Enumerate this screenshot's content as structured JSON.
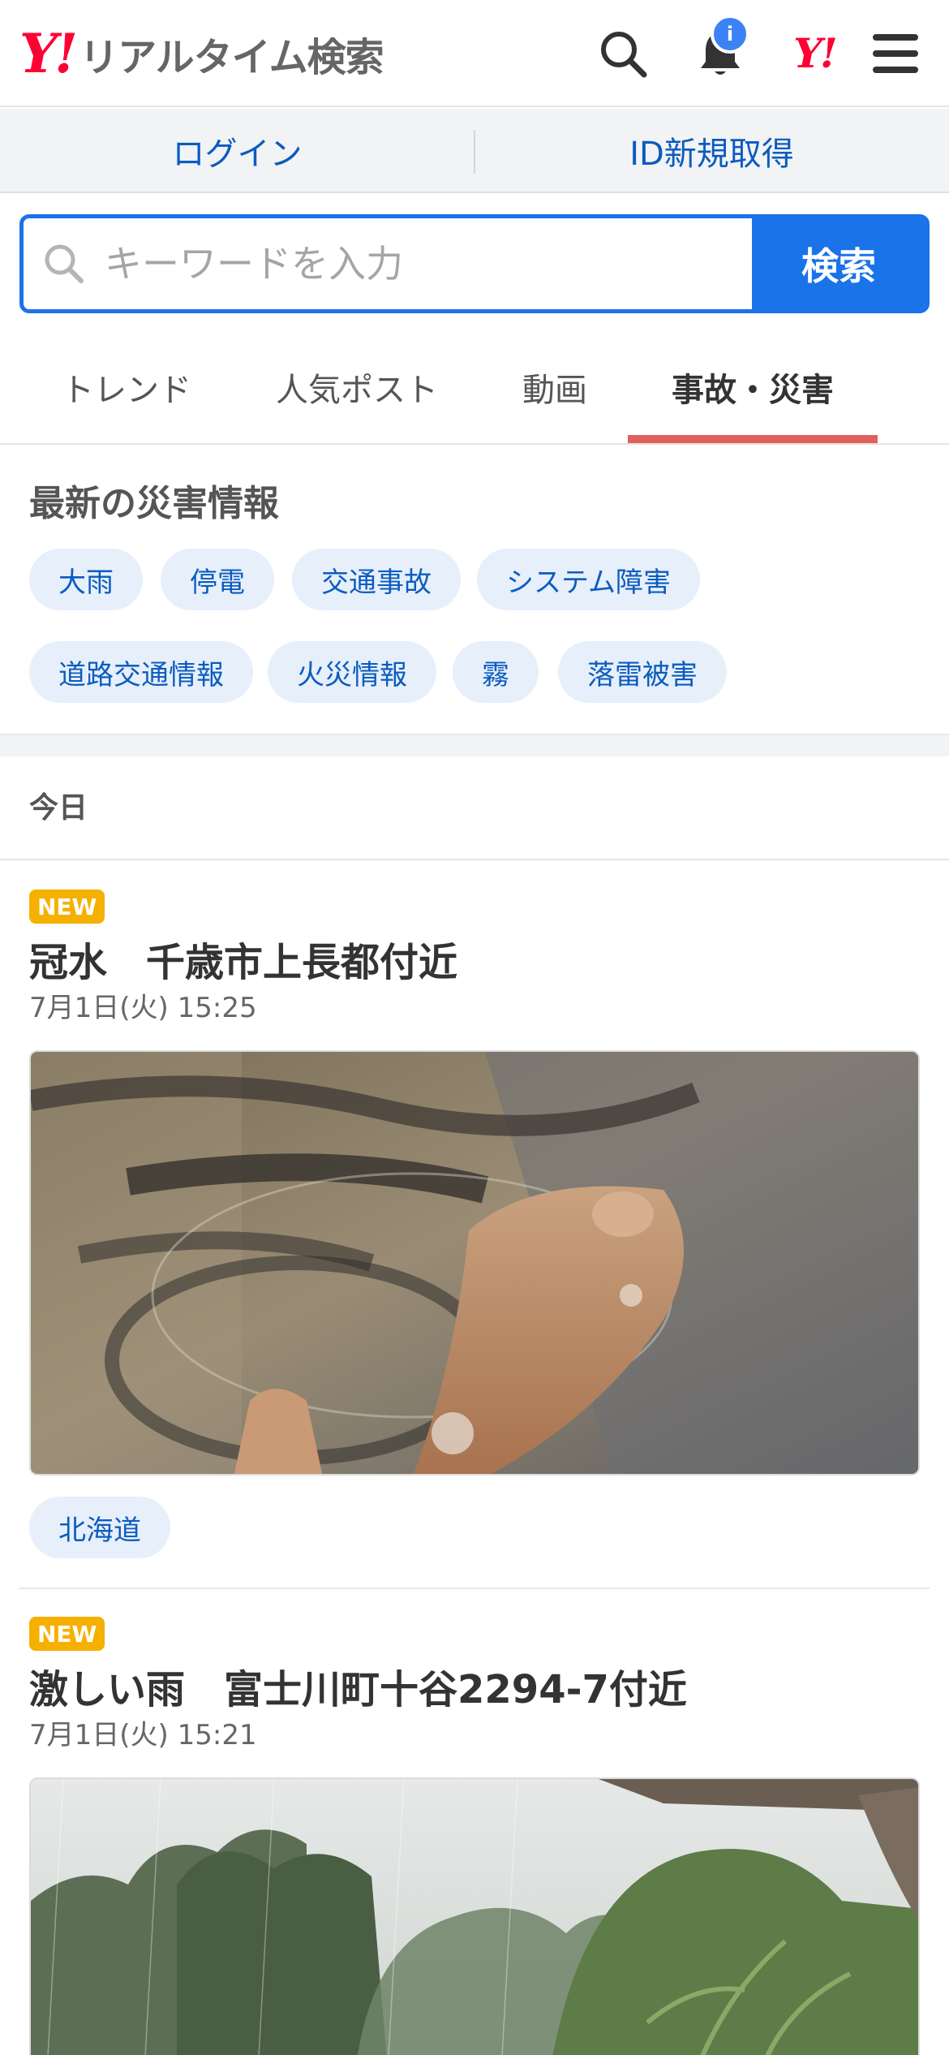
{
  "header": {
    "logo_y": "Y!",
    "logo_text": "リアルタイム検索",
    "notification_badge": "i",
    "yahoo_mark": "Y!"
  },
  "account": {
    "login_label": "ログイン",
    "register_label": "ID新規取得"
  },
  "search": {
    "placeholder": "キーワードを入力",
    "button_label": "検索"
  },
  "tabs": [
    {
      "label": "トレンド",
      "active": false
    },
    {
      "label": "人気ポスト",
      "active": false
    },
    {
      "label": "動画",
      "active": false
    },
    {
      "label": "事故・災害",
      "active": true
    }
  ],
  "disaster": {
    "title": "最新の災害情報",
    "chips": [
      "大雨",
      "停電",
      "交通事故",
      "システム障害",
      "道路交通情報",
      "火災情報",
      "霧",
      "落雷被害"
    ]
  },
  "timeline": {
    "day_label": "今日"
  },
  "posts": [
    {
      "badge": "NEW",
      "title": "冠水　千歳市上長都付近",
      "time": "7月1日(火) 15:25",
      "tag": "北海道"
    },
    {
      "badge": "NEW",
      "title": "激しい雨　富士川町十谷2294-7付近",
      "time": "7月1日(火) 15:21"
    }
  ],
  "colors": {
    "brand_red": "#ff0033",
    "search_blue": "#1a73e8",
    "link_blue": "#0b5cbf",
    "tab_indicator": "#e0605e",
    "new_badge": "#f5b000",
    "chip_bg": "#e7effb"
  }
}
